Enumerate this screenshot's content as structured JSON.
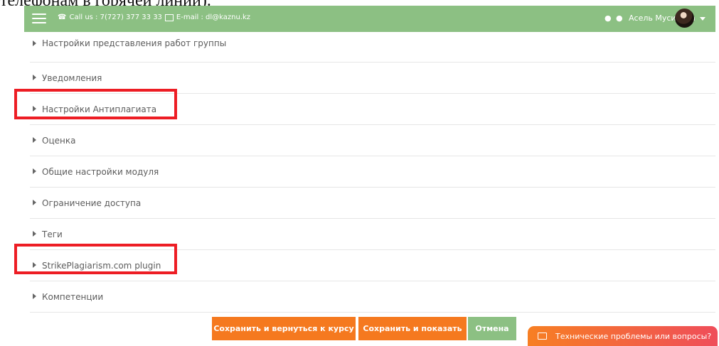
{
  "page_fragment": "телефонам в горячей линии).",
  "navbar": {
    "phone_icon": "phone-icon",
    "call_text": "Call us : 7(727) 377 33 33",
    "mail_icon": "envelope-icon",
    "email_text": "E-mail : dl@kaznu.kz",
    "user_name": "Асель Мусинова"
  },
  "sections": [
    {
      "label": "Настройки представления работ группы"
    },
    {
      "label": "Уведомления"
    },
    {
      "label": "Настройки Антиплагиата"
    },
    {
      "label": "Оценка"
    },
    {
      "label": "Общие настройки модуля"
    },
    {
      "label": "Ограничение доступа"
    },
    {
      "label": "Теги"
    },
    {
      "label": "StrikePlagiarism.com plugin"
    },
    {
      "label": "Компетенции"
    }
  ],
  "buttons": {
    "save_return": "Сохранить и вернуться к курсу",
    "save_show": "Сохранить и показать",
    "cancel": "Отмена"
  },
  "help_tab": {
    "label": "Технические проблемы или вопросы?"
  },
  "colors": {
    "navbar": "#8cc083",
    "primary_button": "#f5791f",
    "highlight": "#ed1d24"
  }
}
